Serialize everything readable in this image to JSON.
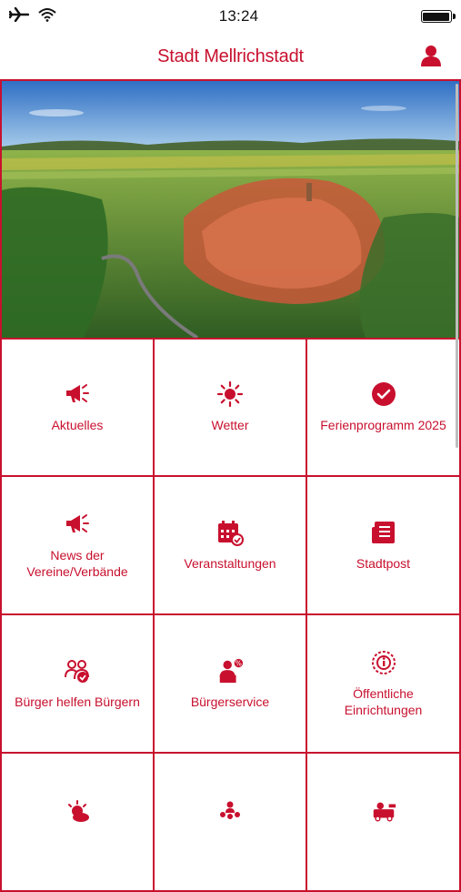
{
  "status_bar": {
    "time": "13:24",
    "icons": [
      "airplane-icon",
      "wifi-icon",
      "battery-icon"
    ]
  },
  "header": {
    "title": "Stadt Mellrichstadt",
    "profile_icon": "user-icon"
  },
  "colors": {
    "accent": "#c8102e",
    "background": "#ffffff"
  },
  "tiles": [
    {
      "label": "Aktuelles",
      "icon": "megaphone-icon"
    },
    {
      "label": "Wetter",
      "icon": "sun-icon"
    },
    {
      "label": "Ferienprogramm 2025",
      "icon": "check-circle-icon"
    },
    {
      "label": "News der Vereine/Verbände",
      "icon": "megaphone-icon"
    },
    {
      "label": "Veranstaltungen",
      "icon": "calendar-check-icon"
    },
    {
      "label": "Stadtpost",
      "icon": "newspaper-icon"
    },
    {
      "label": "Bürger helfen Bürgern",
      "icon": "community-help-icon"
    },
    {
      "label": "Bürgerservice",
      "icon": "service-desk-icon"
    },
    {
      "label": "Öffentliche Einrichtungen",
      "icon": "info-badge-icon"
    },
    {
      "label": "",
      "icon": "weather-cloud-sun-icon"
    },
    {
      "label": "",
      "icon": "people-group-icon"
    },
    {
      "label": "",
      "icon": "fire-truck-icon"
    }
  ]
}
